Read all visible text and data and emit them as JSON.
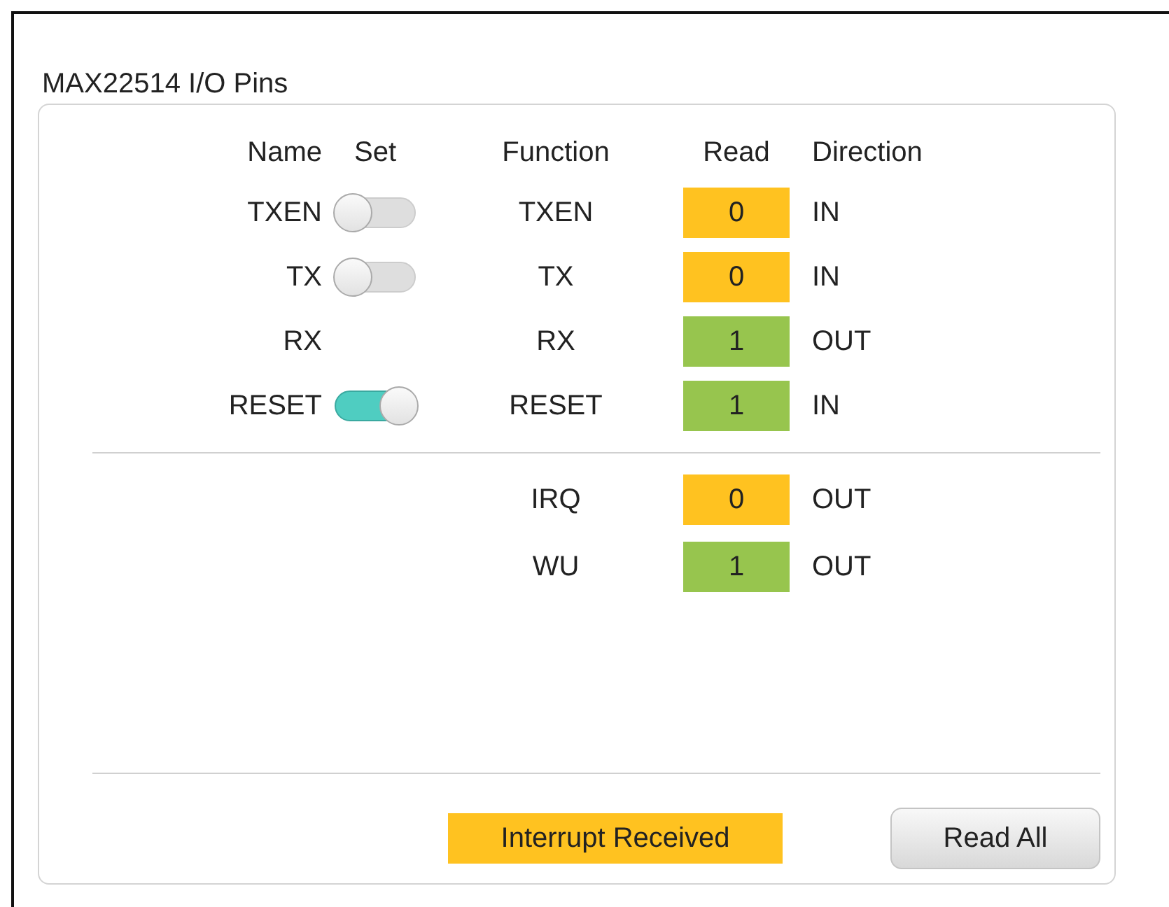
{
  "panel": {
    "title": "MAX22514 I/O Pins"
  },
  "columns": [
    "Name",
    "Set",
    "Function",
    "Read",
    "Direction"
  ],
  "pins": [
    {
      "name": "TXEN",
      "kind": "switch",
      "on": false,
      "function": "TXEN",
      "read": "0",
      "high": false,
      "direction": "IN"
    },
    {
      "name": "TX",
      "kind": "switch",
      "on": false,
      "function": "TX",
      "read": "0",
      "high": false,
      "direction": "IN"
    },
    {
      "name": "RX",
      "kind": "none",
      "function": "RX",
      "read": "1",
      "high": true,
      "direction": "OUT"
    },
    {
      "name": "RESET",
      "kind": "switch",
      "on": true,
      "function": "RESET",
      "read": "1",
      "high": true,
      "direction": "IN"
    }
  ],
  "status_pins": [
    {
      "function": "IRQ",
      "read": "0",
      "high": false,
      "direction": "OUT"
    },
    {
      "function": "WU",
      "read": "1",
      "high": true,
      "direction": "OUT"
    }
  ],
  "interrupt": {
    "label": "Interrupt Received",
    "active": true
  },
  "read_all_button": "Read All"
}
